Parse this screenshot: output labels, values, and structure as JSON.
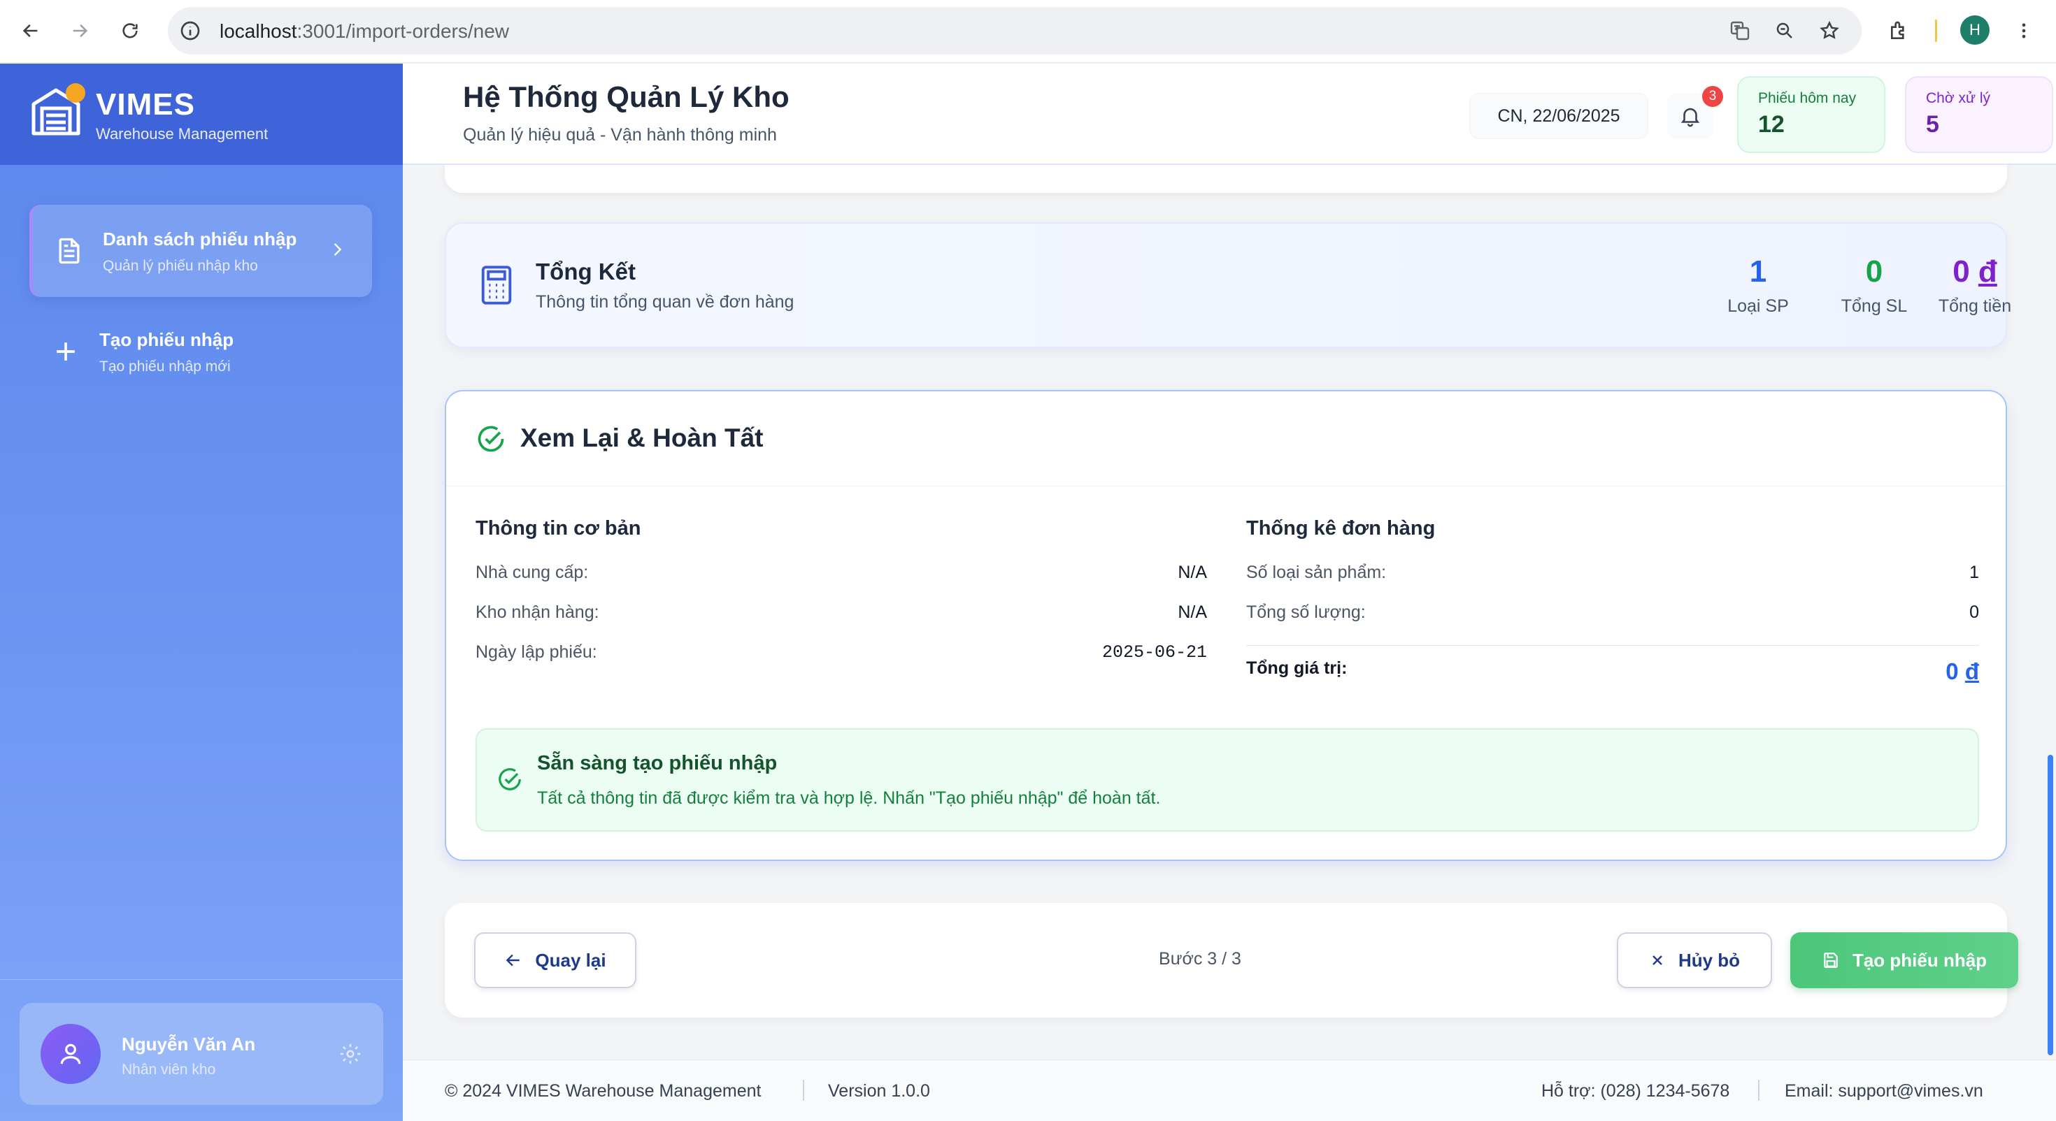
{
  "browser": {
    "url_host": "localhost",
    "url_path": ":3001/import-orders/new",
    "profile_initial": "H"
  },
  "sidebar": {
    "brand": "VIMES",
    "brand_sub": "Warehouse Management",
    "items": [
      {
        "label": "Danh sách phiếu nhập",
        "sub": "Quản lý phiếu nhập kho",
        "active": true
      },
      {
        "label": "Tạo phiếu nhập",
        "sub": "Tạo phiếu nhập mới",
        "active": false
      }
    ],
    "user": {
      "name": "Nguyễn Văn An",
      "role": "Nhân viên kho"
    }
  },
  "header": {
    "title": "Hệ Thống Quản Lý Kho",
    "subtitle": "Quản lý hiệu quả - Vận hành thông minh",
    "date": "CN, 22/06/2025",
    "notification_count": "3",
    "stats": [
      {
        "label": "Phiếu hôm nay",
        "value": "12"
      },
      {
        "label": "Chờ xử lý",
        "value": "5"
      }
    ]
  },
  "summary": {
    "title": "Tổng Kết",
    "subtitle": "Thông tin tổng quan về đơn hàng",
    "metrics": [
      {
        "value": "1",
        "label": "Loại SP"
      },
      {
        "value": "0",
        "label": "Tổng SL"
      },
      {
        "value": "0",
        "currency": "đ",
        "label": "Tổng tiền"
      }
    ]
  },
  "review": {
    "title": "Xem Lại & Hoàn Tất",
    "basic_info": {
      "heading": "Thông tin cơ bản",
      "rows": [
        {
          "label": "Nhà cung cấp:",
          "value": "N/A"
        },
        {
          "label": "Kho nhận hàng:",
          "value": "N/A"
        },
        {
          "label": "Ngày lập phiếu:",
          "value": "2025-06-21"
        }
      ]
    },
    "order_stats": {
      "heading": "Thống kê đơn hàng",
      "rows": [
        {
          "label": "Số loại sản phẩm:",
          "value": "1"
        },
        {
          "label": "Tổng số lượng:",
          "value": "0"
        }
      ],
      "total_label": "Tổng giá trị:",
      "total_value": "0",
      "total_currency": "đ"
    },
    "ready": {
      "title": "Sẵn sàng tạo phiếu nhập",
      "message": "Tất cả thông tin đã được kiểm tra và hợp lệ. Nhấn \"Tạo phiếu nhập\" để hoàn tất."
    }
  },
  "actions": {
    "back": "Quay lại",
    "step": "Bước 3 / 3",
    "cancel": "Hủy bỏ",
    "create": "Tạo phiếu nhập"
  },
  "footer": {
    "copyright": "© 2024 VIMES Warehouse Management",
    "version": "Version 1.0.0",
    "support": "Hỗ trợ: (028) 1234-5678",
    "email": "Email: support@vimes.vn"
  },
  "colors": {
    "sidebar": "#5a86ec",
    "sidebar_header": "#3f63d8",
    "primary": "#2563eb",
    "success": "#16a34a",
    "purple": "#7e22ce"
  }
}
